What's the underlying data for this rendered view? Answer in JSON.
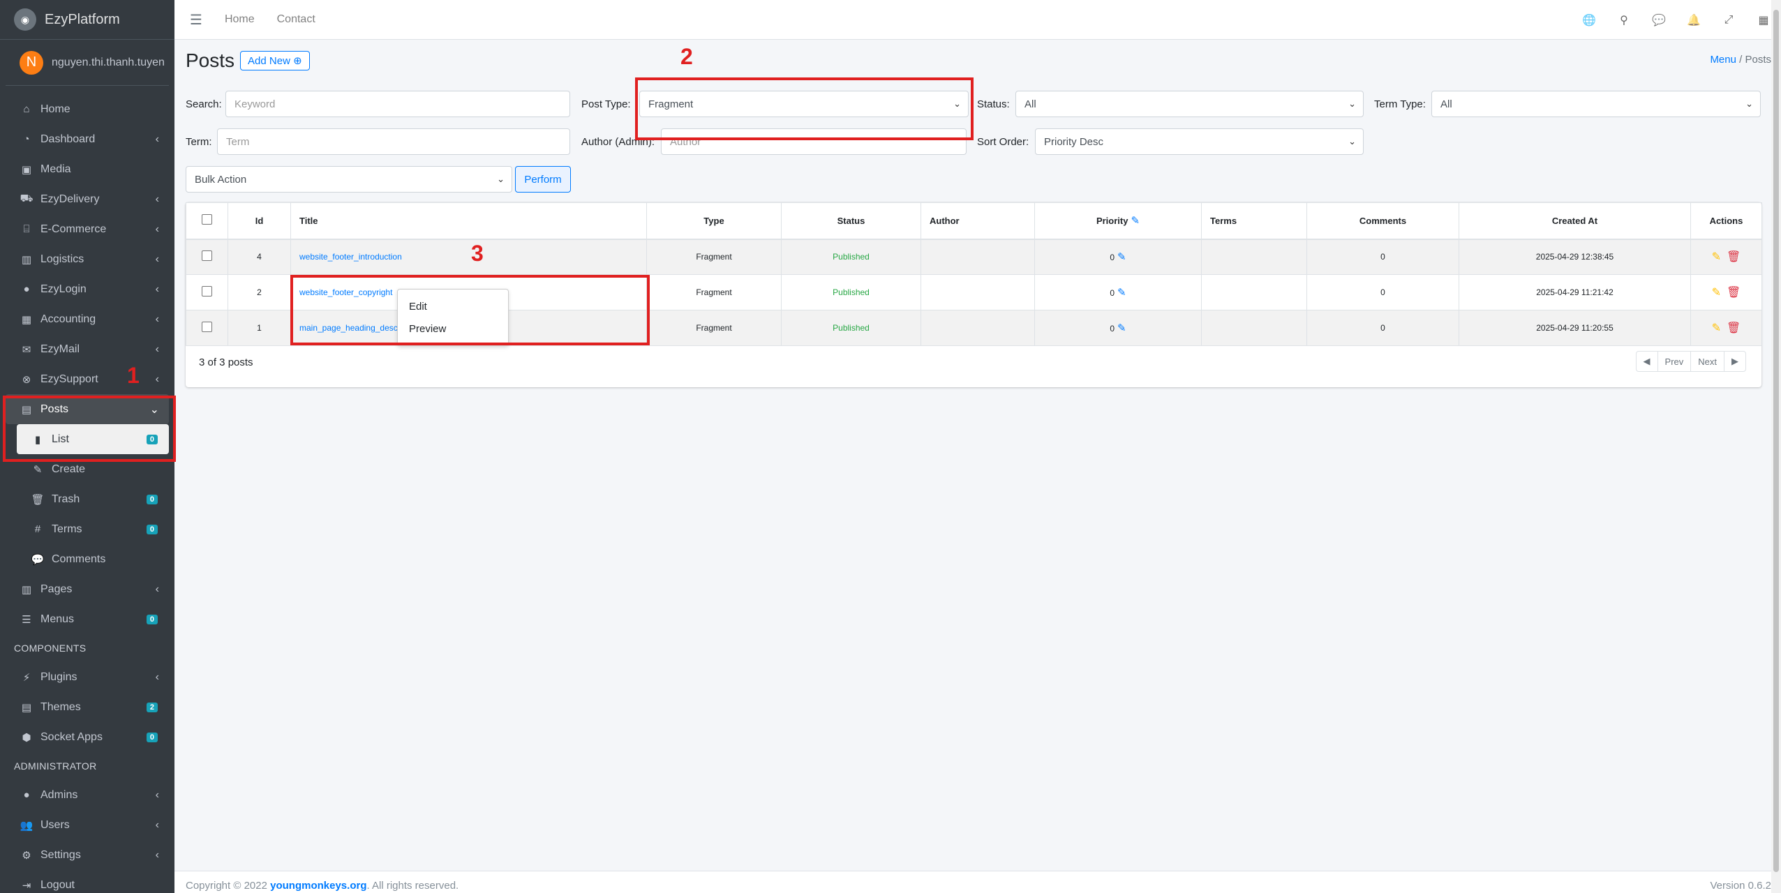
{
  "brand": {
    "name": "EzyPlatform",
    "logo": "platform-logo"
  },
  "user": {
    "initial": "N",
    "name": "nguyen.thi.thanh.tuyen"
  },
  "sidebar": {
    "items": [
      {
        "label": "Home",
        "icon": "home-icon"
      },
      {
        "label": "Dashboard",
        "icon": "dashboard-icon"
      },
      {
        "label": "Media",
        "icon": "image-icon"
      },
      {
        "label": "EzyDelivery",
        "icon": "truck-icon"
      },
      {
        "label": "E-Commerce",
        "icon": "store-icon"
      },
      {
        "label": "Logistics",
        "icon": "warehouse-icon"
      },
      {
        "label": "EzyLogin",
        "icon": "user-key-icon"
      },
      {
        "label": "Accounting",
        "icon": "calculator-icon"
      },
      {
        "label": "EzyMail",
        "icon": "envelope-icon"
      },
      {
        "label": "EzySupport",
        "icon": "lifebuoy-icon"
      },
      {
        "label": "Posts",
        "icon": "newspaper-icon"
      }
    ],
    "posts_sub": [
      {
        "label": "List",
        "badge": "0"
      },
      {
        "label": "Create"
      },
      {
        "label": "Trash",
        "badge": "0"
      },
      {
        "label": "Terms",
        "badge": "0"
      },
      {
        "label": "Comments"
      }
    ],
    "items2": [
      {
        "label": "Pages"
      },
      {
        "label": "Menus",
        "badge": "0"
      }
    ],
    "components_header": "COMPONENTS",
    "components": [
      {
        "label": "Plugins"
      },
      {
        "label": "Themes",
        "badge": "2"
      },
      {
        "label": "Socket Apps",
        "badge": "0"
      }
    ],
    "admin_header": "ADMINISTRATOR",
    "admin": [
      {
        "label": "Admins"
      },
      {
        "label": "Users"
      },
      {
        "label": "Settings"
      },
      {
        "label": "Logout"
      }
    ]
  },
  "topbar": {
    "home": "Home",
    "contact": "Contact"
  },
  "page": {
    "title": "Posts",
    "add_new": "Add New"
  },
  "breadcrumb": {
    "menu": "Menu",
    "sep": "/",
    "current": "Posts"
  },
  "filters": {
    "search_label": "Search:",
    "search_placeholder": "Keyword",
    "post_type_label": "Post Type:",
    "post_type_value": "Fragment",
    "status_label": "Status:",
    "status_value": "All",
    "term_type_label": "Term Type:",
    "term_type_value": "All",
    "term_label": "Term:",
    "term_placeholder": "Term",
    "author_label": "Author (Admin):",
    "author_placeholder": "Author",
    "sort_label": "Sort Order:",
    "sort_value": "Priority Desc",
    "bulk_value": "Bulk Action",
    "perform": "Perform"
  },
  "table": {
    "columns": [
      "Id",
      "Title",
      "Type",
      "Status",
      "Author",
      "Priority",
      "Terms",
      "Comments",
      "Created At",
      "Actions"
    ],
    "rows": [
      {
        "id": "4",
        "title": "website_footer_introduction",
        "type": "Fragment",
        "status": "Published",
        "author": "",
        "priority": "0",
        "terms": "",
        "comments": "0",
        "created": "2025-04-29 12:38:45"
      },
      {
        "id": "2",
        "title": "website_footer_copyright",
        "type": "Fragment",
        "status": "Published",
        "author": "",
        "priority": "0",
        "terms": "",
        "comments": "0",
        "created": "2025-04-29 11:21:42"
      },
      {
        "id": "1",
        "title": "main_page_heading_desc",
        "type": "Fragment",
        "status": "Published",
        "author": "",
        "priority": "0",
        "terms": "",
        "comments": "0",
        "created": "2025-04-29 11:20:55"
      }
    ],
    "count": "3 of 3 posts",
    "prev": "Prev",
    "next": "Next"
  },
  "context_menu": {
    "edit": "Edit",
    "preview": "Preview"
  },
  "annotations": {
    "one": "1",
    "two": "2",
    "three": "3"
  },
  "footer": {
    "prefix": "Copyright © 2022",
    "link": "youngmonkeys.org",
    "suffix": ". All rights reserved.",
    "version": "Version 0.6.2"
  },
  "colors": {
    "sidebar": "#343a40",
    "accent": "#007bff",
    "annotation": "#e02020",
    "published": "#28a745"
  }
}
